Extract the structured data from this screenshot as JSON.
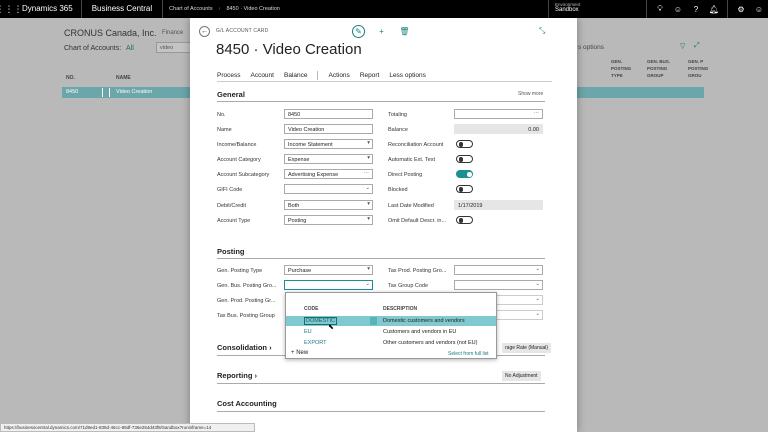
{
  "topbar": {
    "app_name": "Dynamics 365",
    "product": "Business Central",
    "breadcrumb": [
      "Chart of Accounts",
      "8450 · Video Creation"
    ],
    "environment_label": "Environment",
    "environment_value": "Sandbox"
  },
  "background": {
    "company": "CRONUS Canada, Inc.",
    "finance": "Finance",
    "list_title": "Chart of Accounts:",
    "filter": "All",
    "search": "video",
    "right_search": "s options",
    "columns": [
      "NO.",
      "NAME"
    ],
    "right_columns": [
      "GEN. POSTING TYPE",
      "GEN. BUS. POSTING GROUP",
      "GEN. P POSTING GROU"
    ],
    "row": {
      "no": "8450",
      "name": "Video Creation"
    }
  },
  "card": {
    "caption": "G/L ACCOUNT CARD",
    "title": "8450 · Video Creation",
    "menu": [
      "Process",
      "Account",
      "Balance",
      "Actions",
      "Report",
      "Less options"
    ],
    "general": {
      "title": "General",
      "show_more": "Show more",
      "left_fields": [
        {
          "label": "No.",
          "value": "8450"
        },
        {
          "label": "Name",
          "value": "Video Creation"
        },
        {
          "label": "Income/Balance",
          "value": "Income Statement"
        },
        {
          "label": "Account Category",
          "value": "Expense"
        },
        {
          "label": "Account Subcategory",
          "value": "Advertising Expense"
        },
        {
          "label": "GIFI Code",
          "value": ""
        },
        {
          "label": "Debit/Credit",
          "value": "Both"
        },
        {
          "label": "Account Type",
          "value": "Posting"
        }
      ],
      "right_fields": [
        {
          "label": "Totaling",
          "value": ""
        },
        {
          "label": "Balance",
          "value": "0.00"
        },
        {
          "label": "Reconciliation Account",
          "value": ""
        },
        {
          "label": "Automatic Ext. Text",
          "value": ""
        },
        {
          "label": "Direct Posting",
          "value": ""
        },
        {
          "label": "Blocked",
          "value": ""
        },
        {
          "label": "Last Date Modified",
          "value": "1/17/2019"
        },
        {
          "label": "Omit Default Descr. in...",
          "value": ""
        }
      ]
    },
    "posting": {
      "title": "Posting",
      "left_fields": [
        {
          "label": "Gen. Posting Type",
          "value": "Purchase"
        },
        {
          "label": "Gen. Bus. Posting Gro...",
          "value": ""
        },
        {
          "label": "Gen. Prod. Posting Gr...",
          "value": ""
        },
        {
          "label": "Tax Bus. Posting Group",
          "value": ""
        }
      ],
      "right_fields": [
        {
          "label": "Tax Prod. Posting Gro...",
          "value": ""
        },
        {
          "label": "Tax Group Code",
          "value": ""
        }
      ]
    },
    "consolidation": {
      "title": "Consolidation",
      "badge": "rage Rate (Manual)"
    },
    "reporting": {
      "title": "Reporting",
      "badge": "No Adjustment"
    },
    "cost_accounting": {
      "title": "Cost Accounting"
    }
  },
  "popup": {
    "headers": {
      "code": "CODE",
      "description": "DESCRIPTION"
    },
    "rows": [
      {
        "code": "DOMESTIC",
        "description": "Domestic customers and vendors"
      },
      {
        "code": "EU",
        "description": "Customers and vendors in EU"
      },
      {
        "code": "EXPORT",
        "description": "Other customers and vendors (not EU)"
      }
    ],
    "new_label": "New",
    "full_list_label": "Select from full list"
  },
  "status_url": "https://businesscentral.dynamics.com/71d9ed1-835d-46cc-89df-736e254d43f8/Sandbox?runinframe=14",
  "colors": {
    "accent": "#1a8f95",
    "selection": "#80c9ce"
  }
}
